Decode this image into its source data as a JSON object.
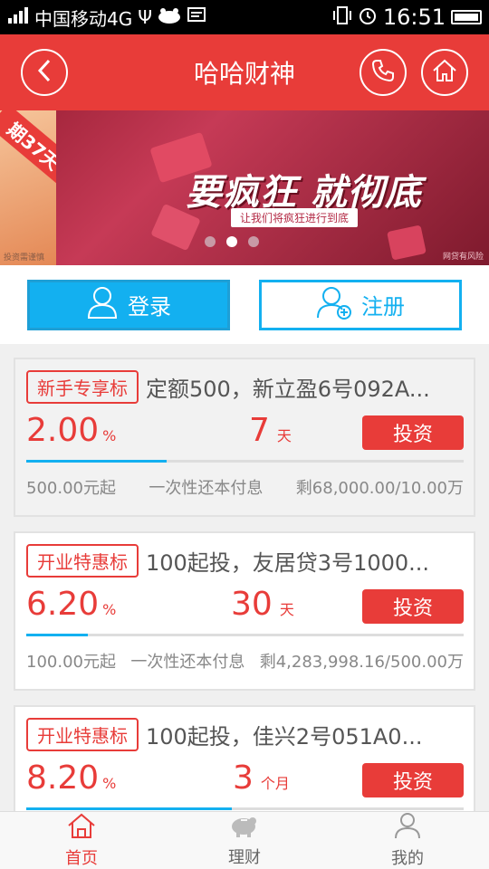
{
  "status_bar": {
    "carrier": "中国移动4G",
    "time": "16:51"
  },
  "header": {
    "title": "哈哈财神"
  },
  "banner": {
    "left_text": "期37天",
    "left_note": "投资需谨慎",
    "headline": "要疯狂 就彻底",
    "subtitle": "让我们将疯狂进行到底",
    "note": "网贷有风险"
  },
  "auth": {
    "login_label": "登录",
    "register_label": "注册"
  },
  "products": [
    {
      "tag": "新手专享标",
      "title": "定额500，新立盈6号092A...",
      "rate": "2.00",
      "rate_unit": "%",
      "term": "7",
      "term_unit": "天",
      "invest_label": "投资",
      "progress": 0.32,
      "min_amount": "500.00元起",
      "repay_method": "一次性还本付息",
      "remaining": "剩68,000.00/10.00万"
    },
    {
      "tag": "开业特惠标",
      "title": "100起投，友居贷3号1000...",
      "rate": "6.20",
      "rate_unit": "%",
      "term": "30",
      "term_unit": "天",
      "invest_label": "投资",
      "progress": 0.14,
      "min_amount": "100.00元起",
      "repay_method": "一次性还本付息",
      "remaining": "剩4,283,998.16/500.00万"
    },
    {
      "tag": "开业特惠标",
      "title": "100起投，佳兴2号051A0...",
      "rate": "8.20",
      "rate_unit": "%",
      "term": "3",
      "term_unit": "个月",
      "invest_label": "投资",
      "progress": 0.47,
      "min_amount": "",
      "repay_method": "",
      "remaining": ""
    }
  ],
  "tabbar": {
    "home_label": "首页",
    "finance_label": "理财",
    "mine_label": "我的"
  },
  "colors": {
    "brand_red": "#e83c39",
    "accent_blue": "#13b0f0"
  }
}
